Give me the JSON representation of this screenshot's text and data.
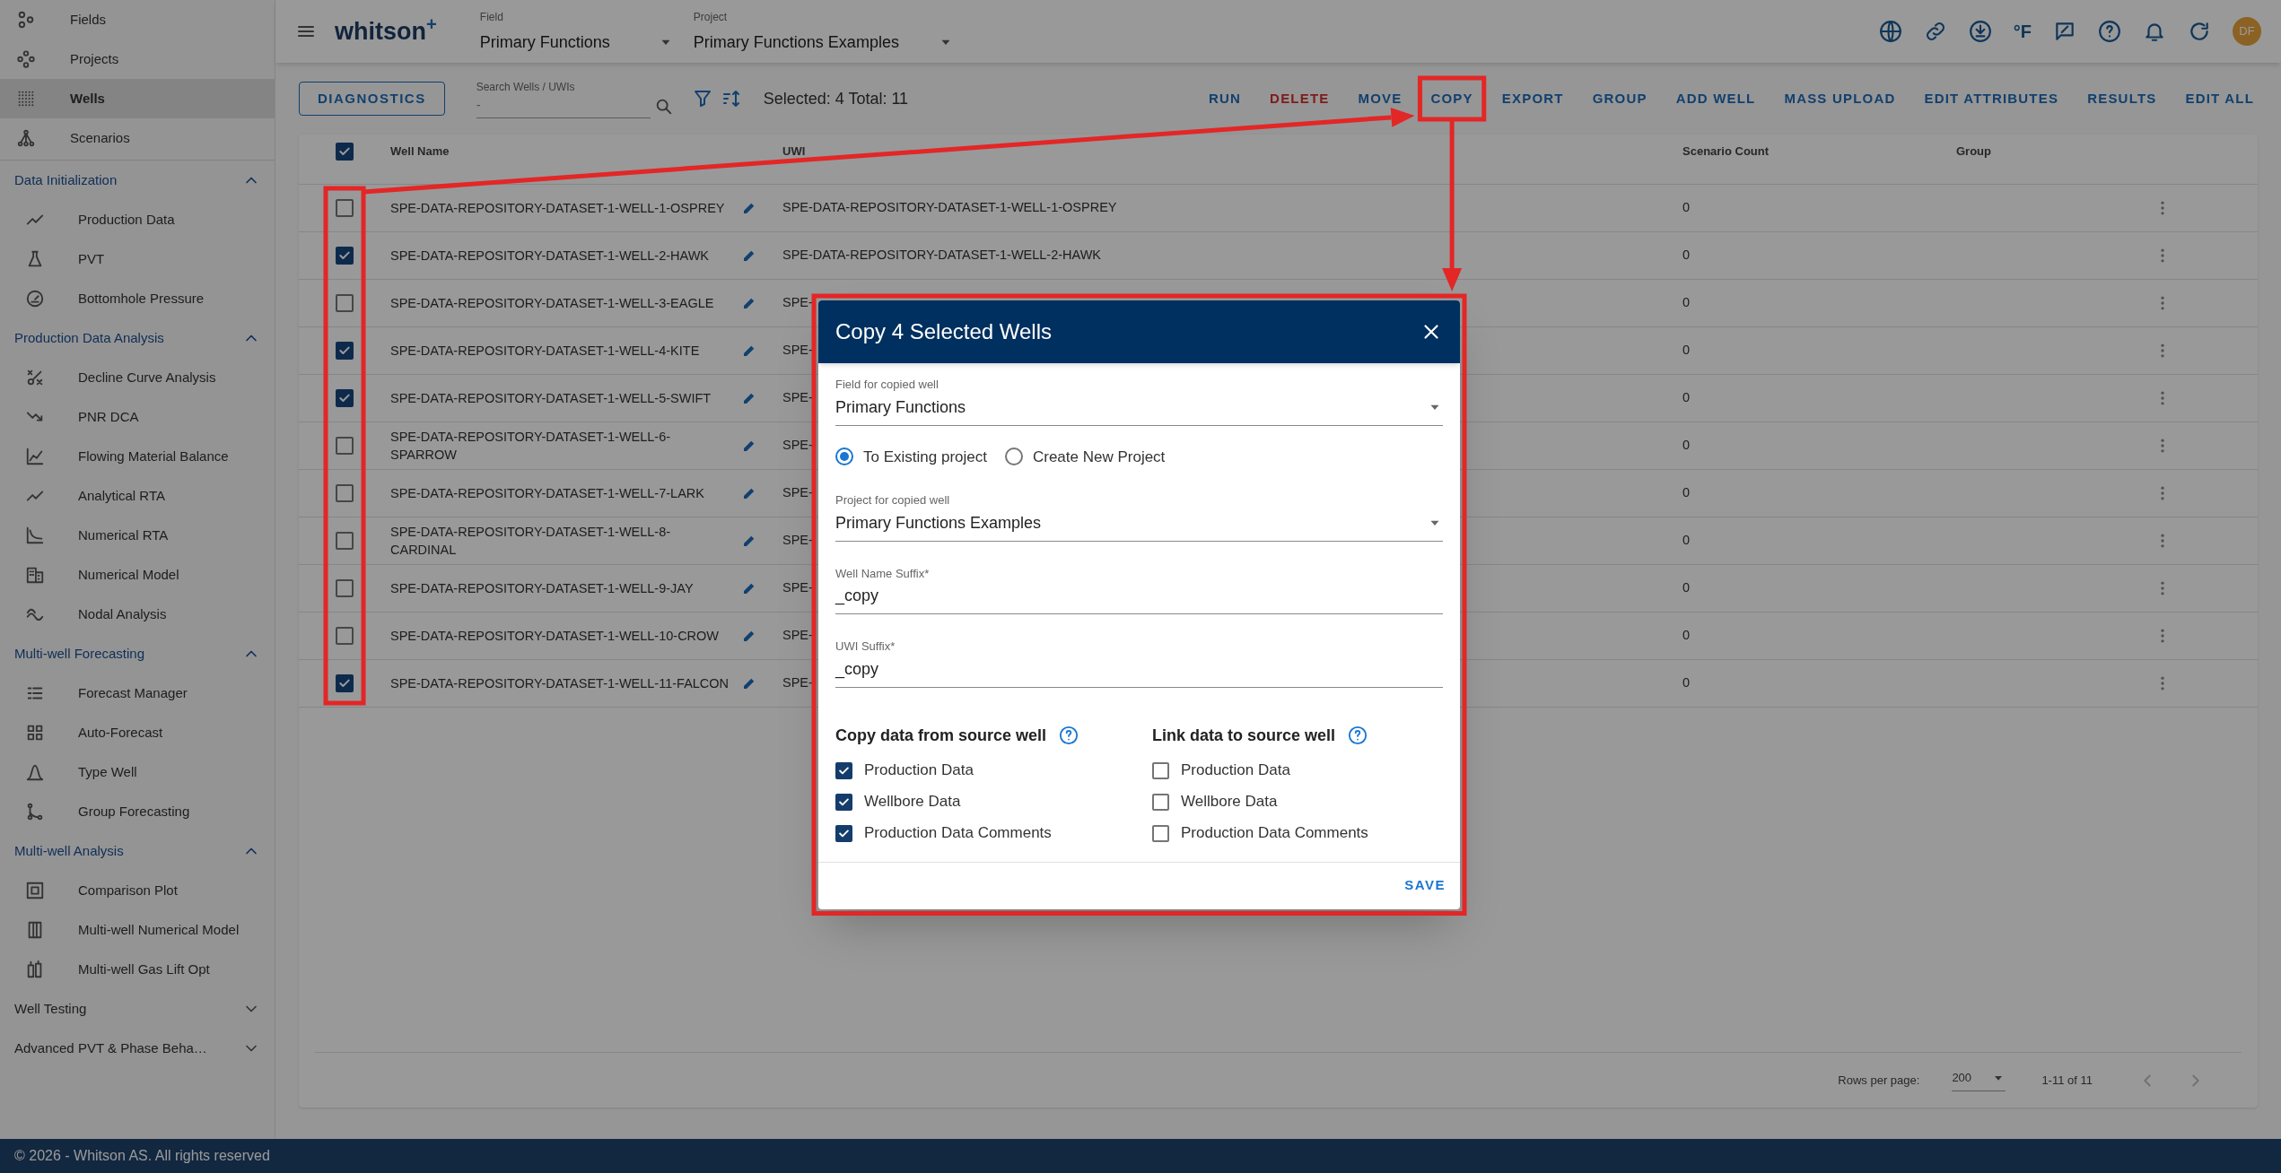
{
  "sidebar": {
    "nav_items": [
      {
        "label": "Fields",
        "selected": false
      },
      {
        "label": "Projects",
        "selected": false
      },
      {
        "label": "Wells",
        "selected": true
      },
      {
        "label": "Scenarios",
        "selected": false
      }
    ],
    "sections": [
      {
        "title": "Data Initialization",
        "expanded": true,
        "items": [
          {
            "label": "Production Data"
          },
          {
            "label": "PVT"
          },
          {
            "label": "Bottomhole Pressure"
          }
        ]
      },
      {
        "title": "Production Data Analysis",
        "expanded": true,
        "items": [
          {
            "label": "Decline Curve Analysis"
          },
          {
            "label": "PNR DCA"
          },
          {
            "label": "Flowing Material Balance"
          },
          {
            "label": "Analytical RTA"
          },
          {
            "label": "Numerical RTA"
          },
          {
            "label": "Numerical Model"
          },
          {
            "label": "Nodal Analysis"
          }
        ]
      },
      {
        "title": "Multi-well Forecasting",
        "expanded": true,
        "items": [
          {
            "label": "Forecast Manager"
          },
          {
            "label": "Auto-Forecast"
          },
          {
            "label": "Type Well"
          },
          {
            "label": "Group Forecasting"
          }
        ]
      },
      {
        "title": "Multi-well Analysis",
        "expanded": true,
        "items": [
          {
            "label": "Comparison Plot"
          },
          {
            "label": "Multi-well Numerical Model"
          },
          {
            "label": "Multi-well Gas Lift Opt"
          }
        ]
      },
      {
        "title": "Well Testing",
        "expanded": false
      },
      {
        "title": "Advanced PVT & Phase Beha…",
        "expanded": false
      }
    ]
  },
  "header": {
    "logo": "whitson$^{+}$",
    "field": {
      "label": "Field",
      "value": "Primary Functions"
    },
    "project": {
      "label": "Project",
      "value": "Primary Functions Examples"
    },
    "unit_toggle": "°F",
    "avatar": "DF"
  },
  "toolbar": {
    "diagnostics": "DIAGNOSTICS",
    "search": {
      "label": "Search Wells / UWIs",
      "placeholder": "-"
    },
    "selection_summary": "Selected: 4 Total: 11",
    "actions": [
      {
        "label": "RUN",
        "kind": "normal"
      },
      {
        "label": "DELETE",
        "kind": "danger"
      },
      {
        "label": "MOVE",
        "kind": "normal"
      },
      {
        "label": "COPY",
        "kind": "normal"
      },
      {
        "label": "EXPORT",
        "kind": "normal"
      },
      {
        "label": "GROUP",
        "kind": "normal"
      },
      {
        "label": "ADD WELL",
        "kind": "normal"
      },
      {
        "label": "MASS UPLOAD",
        "kind": "normal"
      },
      {
        "label": "EDIT ATTRIBUTES",
        "kind": "normal"
      },
      {
        "label": "RESULTS",
        "kind": "normal"
      },
      {
        "label": "EDIT ALL",
        "kind": "normal"
      }
    ]
  },
  "table": {
    "header_checked": true,
    "columns": [
      "Well Name",
      "UWI",
      "Scenario Count",
      "Group"
    ],
    "rows": [
      {
        "selected": false,
        "well_name": "SPE-DATA-REPOSITORY-DATASET-1-WELL-1-OSPREY",
        "uwi": "SPE-DATA-REPOSITORY-DATASET-1-WELL-1-OSPREY",
        "scenario_count": "0"
      },
      {
        "selected": true,
        "well_name": "SPE-DATA-REPOSITORY-DATASET-1-WELL-2-HAWK",
        "uwi": "SPE-DATA-REPOSITORY-DATASET-1-WELL-2-HAWK",
        "scenario_count": "0"
      },
      {
        "selected": false,
        "well_name": "SPE-DATA-REPOSITORY-DATASET-1-WELL-3-EAGLE",
        "uwi": "SPE-",
        "scenario_count": "0"
      },
      {
        "selected": true,
        "well_name": "SPE-DATA-REPOSITORY-DATASET-1-WELL-4-KITE",
        "uwi": "SPE-",
        "scenario_count": "0"
      },
      {
        "selected": true,
        "well_name": "SPE-DATA-REPOSITORY-DATASET-1-WELL-5-SWIFT",
        "uwi": "SPE-",
        "scenario_count": "0"
      },
      {
        "selected": false,
        "well_name": "SPE-DATA-REPOSITORY-DATASET-1-WELL-6-SPARROW",
        "uwi": "SPE-",
        "scenario_count": "0"
      },
      {
        "selected": false,
        "well_name": "SPE-DATA-REPOSITORY-DATASET-1-WELL-7-LARK",
        "uwi": "SPE-",
        "scenario_count": "0"
      },
      {
        "selected": false,
        "well_name": "SPE-DATA-REPOSITORY-DATASET-1-WELL-8-CARDINAL",
        "uwi": "SPE-",
        "scenario_count": "0"
      },
      {
        "selected": false,
        "well_name": "SPE-DATA-REPOSITORY-DATASET-1-WELL-9-JAY",
        "uwi": "SPE-",
        "scenario_count": "0"
      },
      {
        "selected": false,
        "well_name": "SPE-DATA-REPOSITORY-DATASET-1-WELL-10-CROW",
        "uwi": "SPE-",
        "scenario_count": "0"
      },
      {
        "selected": true,
        "well_name": "SPE-DATA-REPOSITORY-DATASET-1-WELL-11-FALCON",
        "uwi": "SPE-",
        "scenario_count": "0"
      }
    ]
  },
  "pagination": {
    "rows_per_page_label": "Rows per page:",
    "rows_per_page": "200",
    "range": "1-11 of 11"
  },
  "dialog": {
    "title": "Copy 4 Selected Wells",
    "controls": [
      {
        "kind": "select",
        "label": "Field for copied well",
        "value": "Primary Functions"
      },
      {
        "kind": "radio_group",
        "options": [
          {
            "label": "To Existing project",
            "selected": true
          },
          {
            "label": "Create New Project",
            "selected": false
          }
        ]
      },
      {
        "kind": "select",
        "label": "Project for copied well",
        "value": "Primary Functions Examples"
      },
      {
        "kind": "text",
        "label": "Well Name Suffix*",
        "value": "_copy"
      },
      {
        "kind": "text",
        "label": "UWI Suffix*",
        "value": "_copy"
      }
    ],
    "option_groups": [
      {
        "title": "Copy data from source well",
        "options": [
          {
            "label": "Production Data",
            "checked": true
          },
          {
            "label": "Wellbore Data",
            "checked": true
          },
          {
            "label": "Production Data Comments",
            "checked": true
          }
        ]
      },
      {
        "title": "Link data to source well",
        "options": [
          {
            "label": "Production Data",
            "checked": false
          },
          {
            "label": "Wellbore Data",
            "checked": false
          },
          {
            "label": "Production Data Comments",
            "checked": false
          }
        ]
      }
    ],
    "save": "SAVE"
  },
  "footer": "© 2026 - Whitson AS. All rights reserved"
}
